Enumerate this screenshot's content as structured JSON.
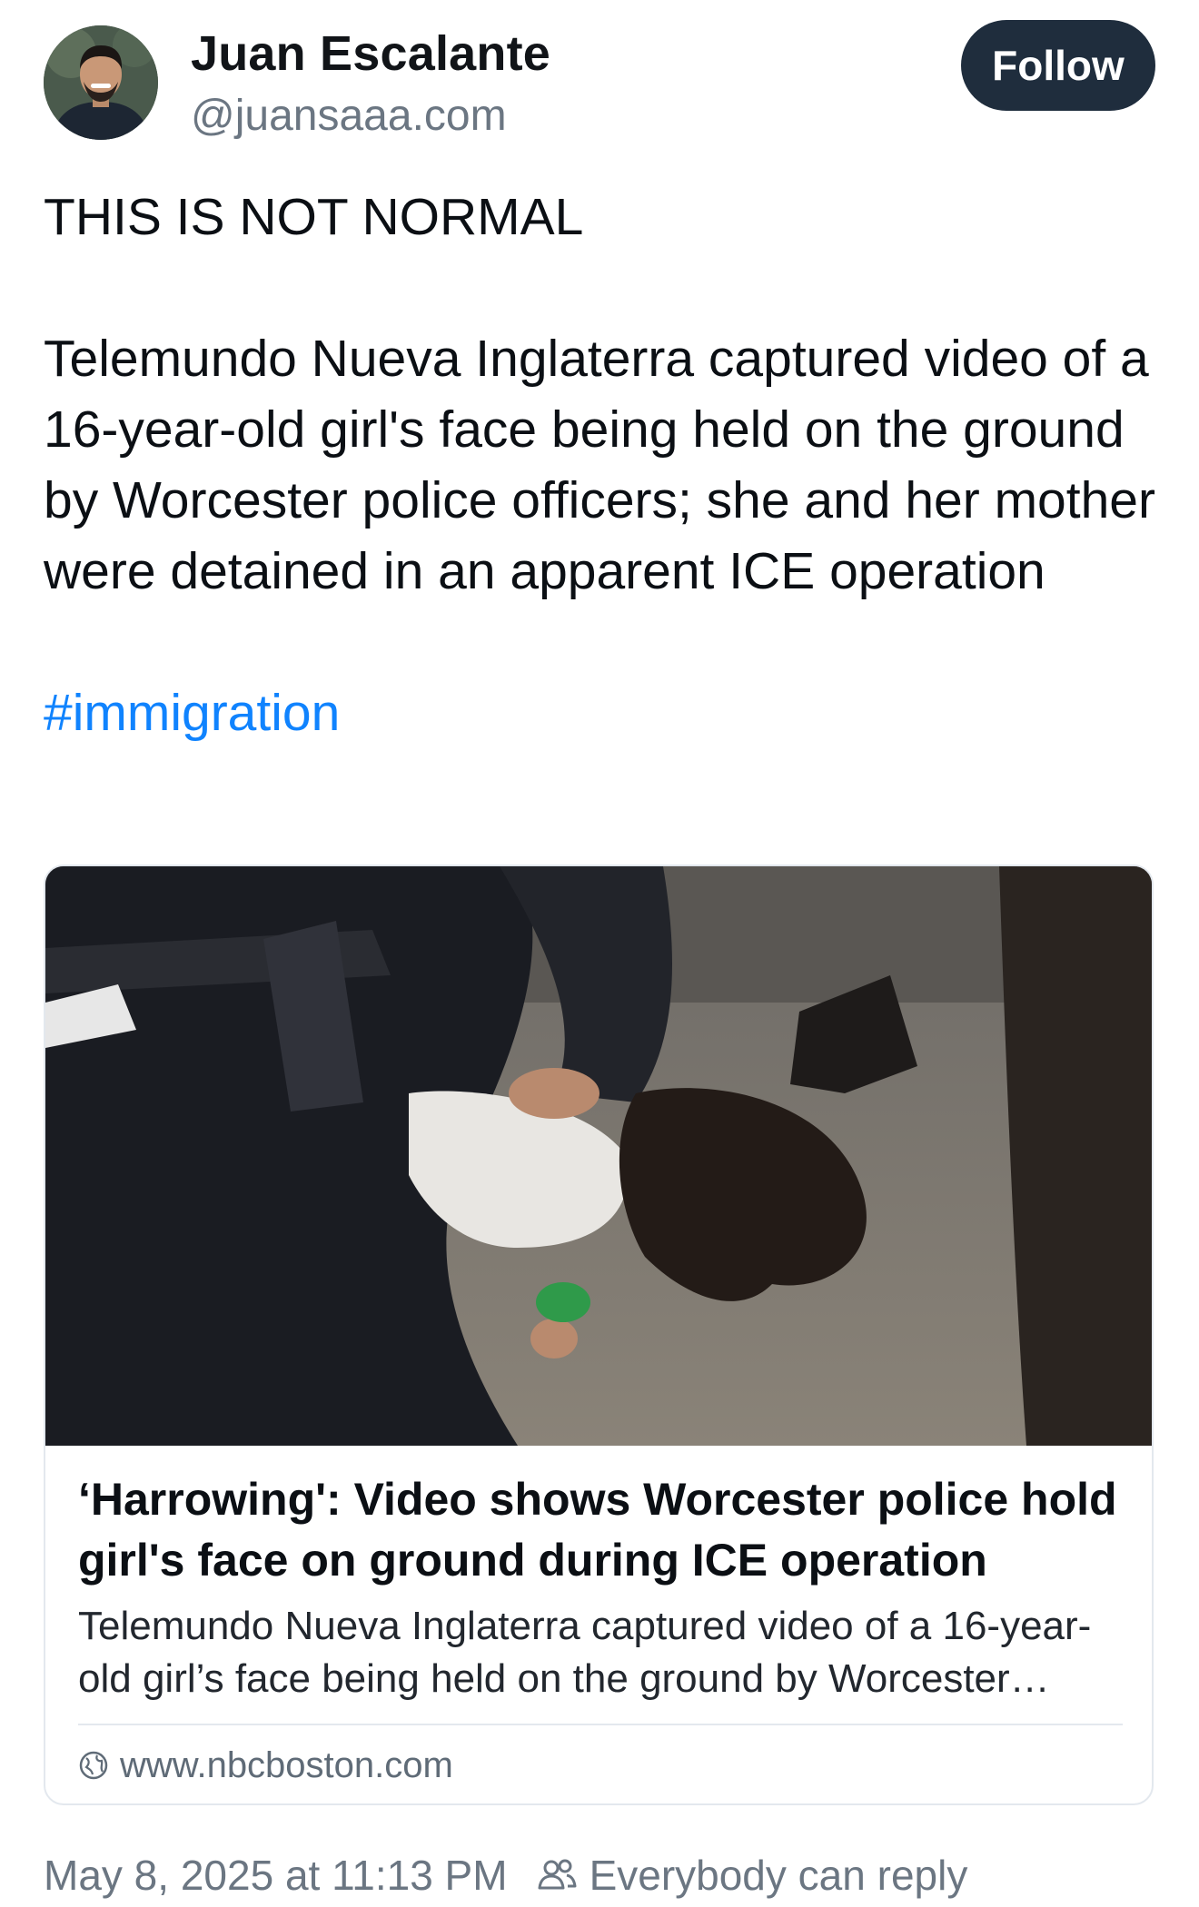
{
  "author": {
    "display_name": "Juan Escalante",
    "handle": "@juansaaa.com"
  },
  "follow_label": "Follow",
  "post": {
    "headline": "THIS IS NOT NORMAL",
    "body": "Telemundo Nueva Inglaterra captured video of a 16-year-old girl's face being held on the ground by Worcester police officers; she and her mother were detained in an apparent ICE operation",
    "hashtag": "#immigration"
  },
  "link_card": {
    "title": "‘Harrowing': Video shows Worcester police hold girl's face on ground during ICE operation",
    "description": "Telemundo Nueva Inglaterra captured video of a 16-year-old girl’s face being held on the ground by Worcester police officers; she and her mother were detained in an apparent ICE operation",
    "domain": "www.nbcboston.com",
    "icon": "globe-icon"
  },
  "footer": {
    "timestamp": "May 8, 2025 at 11:13 PM",
    "reply_setting": "Everybody can reply",
    "reply_icon": "people-icon"
  },
  "colors": {
    "follow_button_bg": "#1f2d3d",
    "hashtag": "#1083fe",
    "muted_text": "#6b7682"
  }
}
